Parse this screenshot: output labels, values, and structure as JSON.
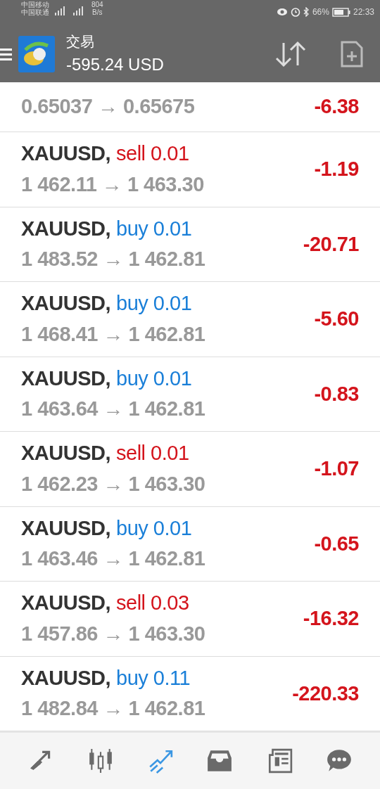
{
  "status_bar": {
    "carriers": [
      "中国移动",
      "中国联通"
    ],
    "speed": "804",
    "speed_unit": "B/s",
    "battery_text": "66%",
    "time": "22:33"
  },
  "header": {
    "title": "交易",
    "balance": "-595.24 USD"
  },
  "trades": [
    {
      "kind": "partial",
      "prices": "0.65037 → 0.65675",
      "profit": "-6.38"
    },
    {
      "kind": "full",
      "symbol": "XAUUSD,",
      "order": "sell 0.01",
      "color": "#d4141c",
      "prices": "1 462.11 → 1 463.30",
      "profit": "-1.19"
    },
    {
      "kind": "full",
      "symbol": "XAUUSD,",
      "order": "buy 0.01",
      "color": "#1a7fd8",
      "prices": "1 483.52 → 1 462.81",
      "profit": "-20.71"
    },
    {
      "kind": "full",
      "symbol": "XAUUSD,",
      "order": "buy 0.01",
      "color": "#1a7fd8",
      "prices": "1 468.41 → 1 462.81",
      "profit": "-5.60"
    },
    {
      "kind": "full",
      "symbol": "XAUUSD,",
      "order": "buy 0.01",
      "color": "#1a7fd8",
      "prices": "1 463.64 → 1 462.81",
      "profit": "-0.83"
    },
    {
      "kind": "full",
      "symbol": "XAUUSD,",
      "order": "sell 0.01",
      "color": "#d4141c",
      "prices": "1 462.23 → 1 463.30",
      "profit": "-1.07"
    },
    {
      "kind": "full",
      "symbol": "XAUUSD,",
      "order": "buy 0.01",
      "color": "#1a7fd8",
      "prices": "1 463.46 → 1 462.81",
      "profit": "-0.65"
    },
    {
      "kind": "full",
      "symbol": "XAUUSD,",
      "order": "sell 0.03",
      "color": "#d4141c",
      "prices": "1 457.86 → 1 463.30",
      "profit": "-16.32"
    },
    {
      "kind": "full",
      "symbol": "XAUUSD,",
      "order": "buy 0.11",
      "color": "#1a7fd8",
      "prices": "1 482.84 → 1 462.81",
      "profit": "-220.33"
    }
  ],
  "bottom_nav": [
    {
      "kind": "quotes",
      "selected": false
    },
    {
      "kind": "chart",
      "selected": false
    },
    {
      "kind": "trade",
      "selected": true
    },
    {
      "kind": "history",
      "selected": false
    },
    {
      "kind": "news",
      "selected": false
    },
    {
      "kind": "messages",
      "selected": false
    }
  ]
}
